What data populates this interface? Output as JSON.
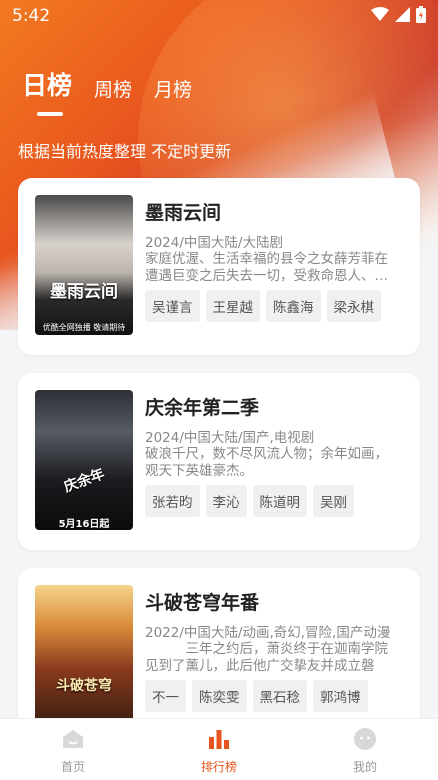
{
  "status": {
    "time": "5:42"
  },
  "tabs": [
    {
      "label": "日榜"
    },
    {
      "label": "周榜"
    },
    {
      "label": "月榜"
    }
  ],
  "subtitle": "根据当前热度整理 不定时更新",
  "cards": [
    {
      "title": "墨雨云间",
      "meta": "2024/中国大陆/大陆剧",
      "desc": "家庭优渥、生活幸福的县令之女薛芳菲在遭遇巨变之后失去一切，受救命恩人、…",
      "tags": [
        "吴谨言",
        "王星越",
        "陈鑫海",
        "梁永棋"
      ],
      "poster": {
        "title": "墨雨云间",
        "caption": "优酷全网独播 敬请期待",
        "colors": [
          "#3a3a3a",
          "#c9c3bf",
          "#2b2b2b"
        ]
      }
    },
    {
      "title": "庆余年第二季",
      "meta": "2024/中国大陆/国产,电视剧",
      "desc": "破浪千尺，数不尽风流人物；余年如画，观天下英雄豪杰。",
      "tags": [
        "张若昀",
        "李沁",
        "陈道明",
        "吴刚"
      ],
      "poster": {
        "title": "庆余年",
        "caption": "5月16日起",
        "colors": [
          "#1c1e22",
          "#3a3d44",
          "#0d0e10"
        ]
      }
    },
    {
      "title": "斗破苍穹年番",
      "meta": "2022/中国大陆/动画,奇幻,冒险,国产动漫",
      "desc": "三年之约后，萧炎终于在迦南学院见到了薰儿，此后他广交挚友并成立磐门…",
      "tags": [
        "不一",
        "陈奕雯",
        "黑石稔",
        "郭鸿博"
      ],
      "poster": {
        "title": "斗破苍穹",
        "caption": "",
        "colors": [
          "#f2c36a",
          "#b5552a",
          "#3a1e12"
        ]
      }
    }
  ],
  "nav": [
    {
      "label": "首页"
    },
    {
      "label": "排行榜"
    },
    {
      "label": "我的"
    }
  ],
  "colors": {
    "accent": "#e8541e"
  }
}
